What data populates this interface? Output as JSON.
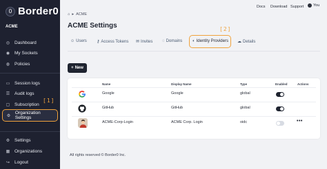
{
  "brand": {
    "name": "Border0",
    "mark": "0"
  },
  "sidebar": {
    "org_name": "ACME",
    "items": [
      {
        "label": "Dashboard",
        "icon": "dashboard-icon"
      },
      {
        "label": "My Sockets",
        "icon": "sockets-icon"
      },
      {
        "label": "Policies",
        "icon": "policies-icon"
      },
      {
        "label": "Session logs",
        "icon": "session-logs-icon"
      },
      {
        "label": "Audit logs",
        "icon": "audit-logs-icon"
      },
      {
        "label": "Subscription",
        "icon": "subscription-icon"
      },
      {
        "label": "Organization Settings",
        "icon": "gear-icon",
        "active": true
      },
      {
        "label": "Settings",
        "icon": "gear-icon"
      },
      {
        "label": "Organizations",
        "icon": "organizations-icon"
      },
      {
        "label": "Logout",
        "icon": "logout-icon"
      }
    ],
    "callout": "[1]"
  },
  "topbar": {
    "docs": "Docs",
    "download": "Download",
    "support": "Support",
    "user": "You"
  },
  "breadcrumb": {
    "home_icon": "home-icon",
    "separator": "▸",
    "current": "ACME"
  },
  "page_title": "ACME Settings",
  "tabs": [
    {
      "label": "Users",
      "icon": "users-icon"
    },
    {
      "label": "Access Tokens",
      "icon": "key-icon"
    },
    {
      "label": "Invites",
      "icon": "invite-icon"
    },
    {
      "label": "Domains",
      "icon": "globe-icon"
    },
    {
      "label": "Identity Providers",
      "icon": "identity-icon",
      "active": true
    },
    {
      "label": "Details",
      "icon": "cloud-icon"
    }
  ],
  "tab_callout": "[2]",
  "new_button": {
    "label": "New",
    "plus": "+"
  },
  "table": {
    "headers": {
      "name": "Name",
      "display_name": "Display Name",
      "type": "Type",
      "enabled": "Enabled",
      "actions": "Actions"
    },
    "rows": [
      {
        "name": "Google",
        "display_name": "Google",
        "type": "global",
        "enabled": true
      },
      {
        "name": "GitHub",
        "display_name": "GitHub",
        "type": "global",
        "enabled": true
      },
      {
        "name": "ACME-Corp-Login",
        "display_name": "ACME Corp. Login",
        "type": "oidc",
        "enabled": false,
        "actions": "•••"
      }
    ]
  },
  "footer": "All rights reserved © Border0 Inc.",
  "colors": {
    "sidebar": "#1e2130",
    "highlight": "#f0a23b",
    "primary": "#1f2430",
    "background": "#f1f2f5"
  }
}
